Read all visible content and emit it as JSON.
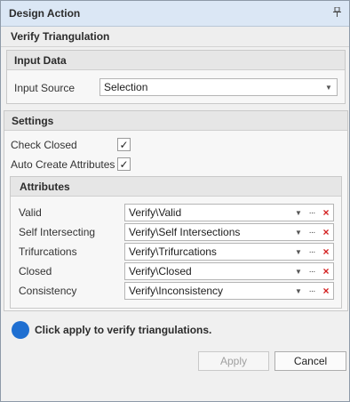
{
  "titlebar": {
    "title": "Design Action",
    "pin_icon": "pin-icon"
  },
  "subheader": {
    "title": "Verify Triangulation"
  },
  "input_data": {
    "header": "Input Data",
    "source_label": "Input Source",
    "source_value": "Selection"
  },
  "settings": {
    "header": "Settings",
    "check_closed_label": "Check Closed",
    "check_closed_checked": true,
    "auto_create_label": "Auto Create Attributes",
    "auto_create_checked": true
  },
  "attributes": {
    "header": "Attributes",
    "rows": [
      {
        "label": "Valid",
        "value": "Verify\\Valid"
      },
      {
        "label": "Self Intersecting",
        "value": "Verify\\Self Intersections"
      },
      {
        "label": "Trifurcations",
        "value": "Verify\\Trifurcations"
      },
      {
        "label": "Closed",
        "value": "Verify\\Closed"
      },
      {
        "label": "Consistency",
        "value": "Verify\\Inconsistency"
      }
    ]
  },
  "info": {
    "message": "Click apply to verify triangulations.",
    "color": "#1f6fd1"
  },
  "buttons": {
    "apply": "Apply",
    "cancel": "Cancel"
  },
  "glyphs": {
    "check": "✓",
    "arrow": "▼",
    "ellipsis": "···",
    "remove": "×"
  }
}
